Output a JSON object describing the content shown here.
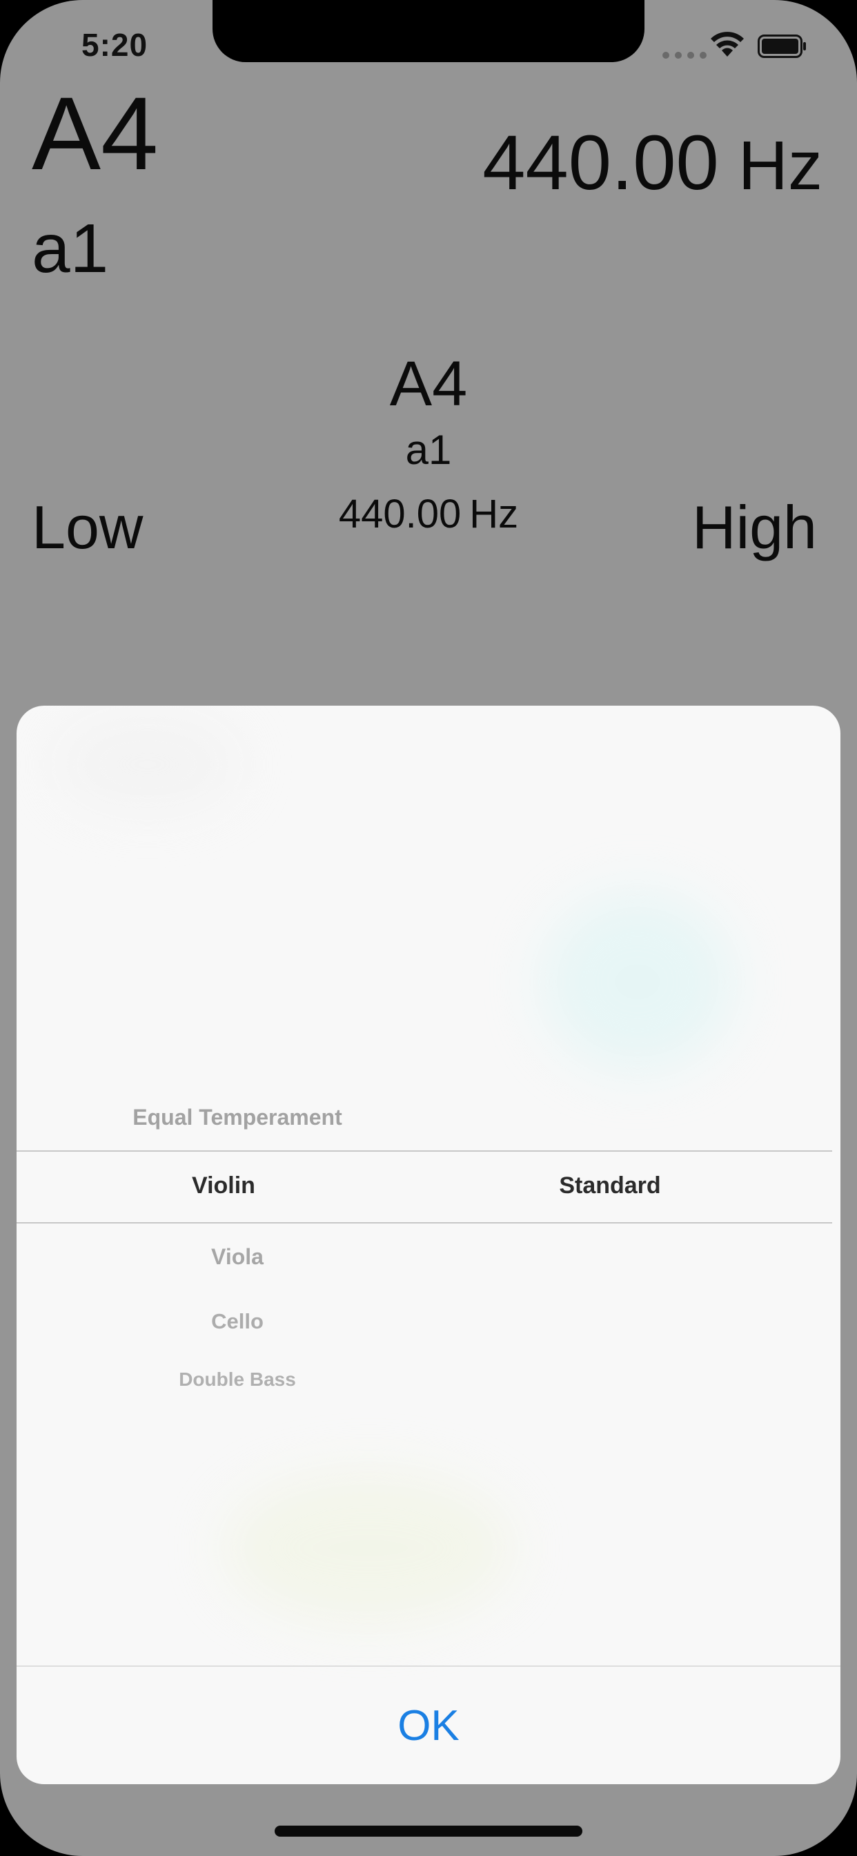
{
  "status_bar": {
    "time": "5:20",
    "icons": [
      "signal-dots-icon",
      "wifi-icon",
      "battery-icon"
    ]
  },
  "tuner": {
    "note": "A4",
    "alt_note": "a1",
    "frequency": "440.00",
    "unit": "Hz",
    "center": {
      "note": "A4",
      "alt_note": "a1",
      "frequency": "440.00",
      "unit": "Hz"
    },
    "low_label": "Low",
    "high_label": "High"
  },
  "picker": {
    "instrument_above": "Equal Temperament",
    "instrument_selected": "Violin",
    "instruments_below": [
      "Viola",
      "Cello",
      "Double Bass"
    ],
    "tuning_selected": "Standard"
  },
  "sheet": {
    "ok_label": "OK"
  },
  "colors": {
    "background": "#959595",
    "sheet": "#f8f8f8",
    "accent": "#1a7fe3"
  }
}
